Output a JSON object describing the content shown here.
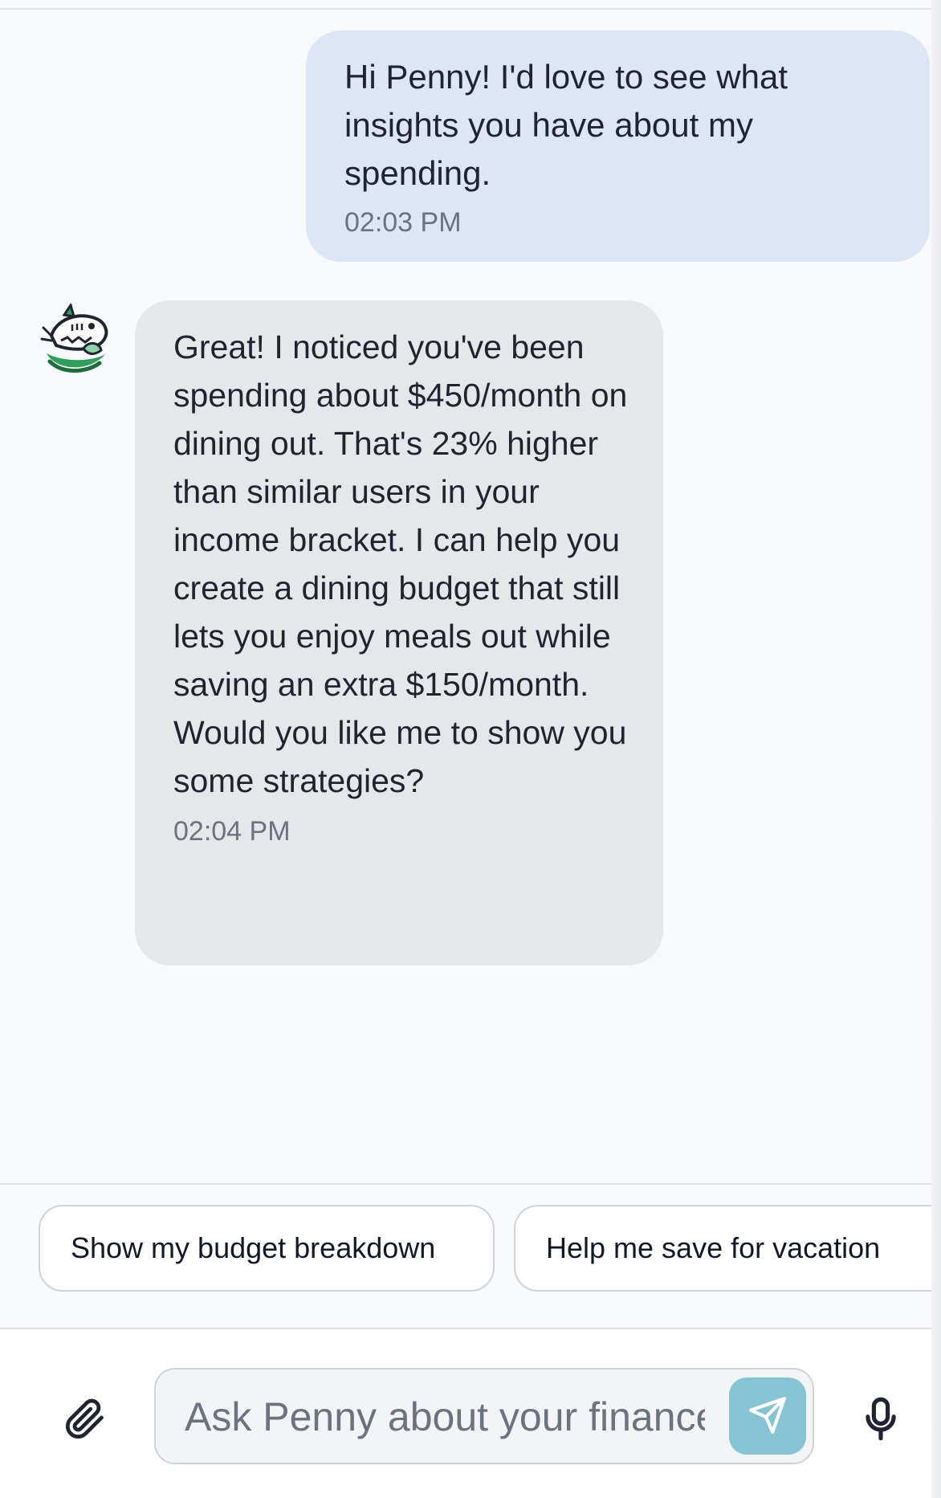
{
  "conversation": {
    "messages": [
      {
        "sender": "user",
        "text": "Hi Penny! I'd love to see what insights you have about my spending.",
        "time": "02:03 PM"
      },
      {
        "sender": "assistant",
        "text": "Great! I noticed you've been spending about $450/month on dining out. That's 23% higher than similar users in your income bracket. I can help you create a dining budget that still lets you enjoy meals out while saving an extra $150/month. Would you like me to show you some strategies?",
        "time": "02:04 PM",
        "avatar_icon": "shark-mascot-icon"
      }
    ]
  },
  "suggestions": [
    "Show my budget breakdown",
    "Help me save for vacation"
  ],
  "composer": {
    "placeholder": "Ask Penny about your finances...",
    "value": "",
    "attach_icon": "paperclip-icon",
    "send_icon": "paper-plane-icon",
    "mic_icon": "microphone-icon"
  },
  "colors": {
    "background": "#f8f9fb",
    "user_bubble": "#dce6f7",
    "assistant_bubble": "#e6e7eb",
    "send_button": "#86c3d3",
    "brand_green": "#2f9e5b"
  }
}
